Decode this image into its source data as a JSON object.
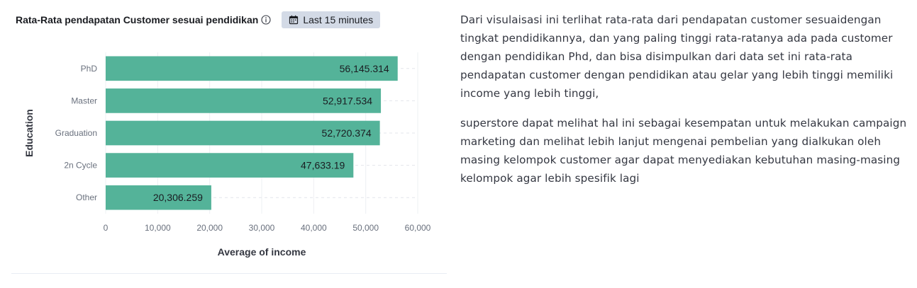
{
  "panel": {
    "title": "Rata-Rata pendapatan Customer sesuai pendidikan",
    "info_icon": "info-circle-icon",
    "time_filter_icon": "calendar-icon",
    "time_filter_label": "Last 15 minutes"
  },
  "chart_data": {
    "type": "bar",
    "orientation": "horizontal",
    "title": "",
    "xlabel": "Average of income",
    "ylabel": "Education",
    "categories": [
      "PhD",
      "Master",
      "Graduation",
      "2n Cycle",
      "Other"
    ],
    "values": [
      56145.314,
      52917.534,
      52720.374,
      47633.19,
      20306.259
    ],
    "value_labels": [
      "56,145.314",
      "52,917.534",
      "52,720.374",
      "47,633.19",
      "20,306.259"
    ],
    "xlim": [
      0,
      60000
    ],
    "x_ticks": [
      "0",
      "10,000",
      "20,000",
      "30,000",
      "40,000",
      "50,000",
      "60,000"
    ],
    "bar_color": "#54b399",
    "grid": true
  },
  "narrative": {
    "paragraphs": [
      "Dari visulaisasi ini terlihat rata-rata dari pendapatan customer sesuaidengan tingkat pendidikannya, dan yang paling tinggi rata-ratanya ada pada customer dengan pendidikan Phd, dan bisa disimpulkan dari data set ini rata-rata pendapatan customer dengan pendidikan atau gelar yang lebih tinggi memiliki income yang lebih tinggi,",
      "superstore dapat melihat hal ini sebagai kesempatan untuk melakukan campaign marketing dan melihat lebih lanjut mengenai pembelian yang dialkukan oleh masing kelompok customer agar dapat menyediakan kebutuhan masing-masing kelompok agar lebih spesifik lagi"
    ]
  }
}
